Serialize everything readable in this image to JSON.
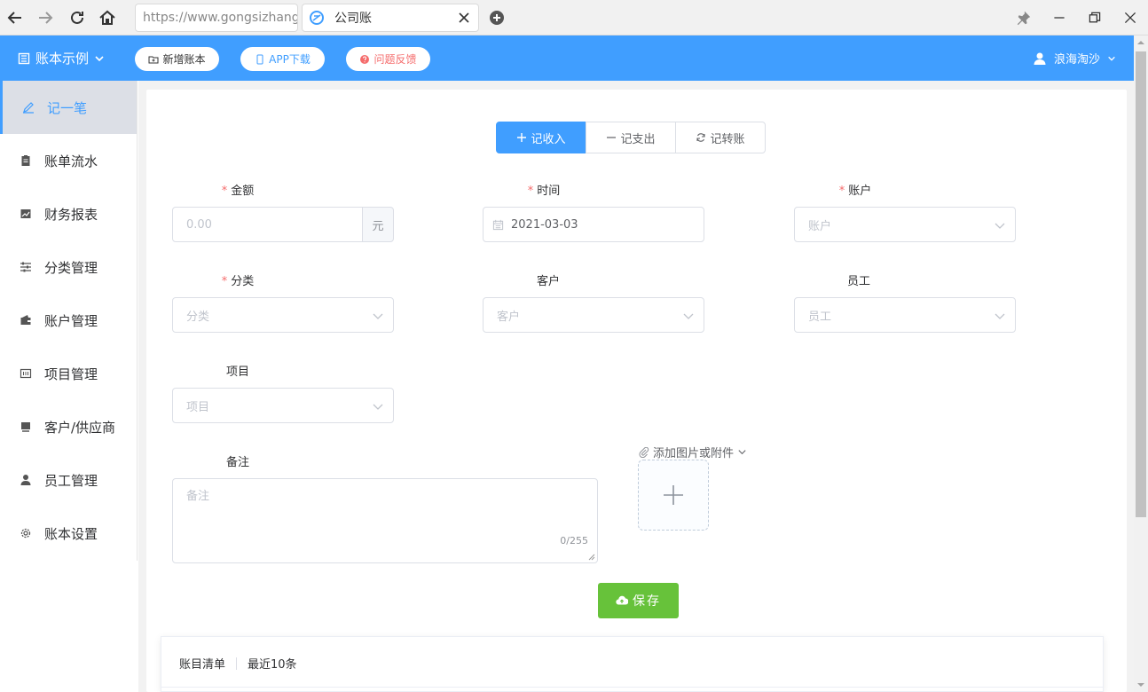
{
  "browser": {
    "url": "https://www.gongsizhang.c",
    "tab_title": "公司账"
  },
  "header": {
    "book_name": "账本示例",
    "buttons": {
      "new_book": "新增账本",
      "app_download": "APP下载",
      "feedback": "问题反馈"
    },
    "user": "浪海淘沙"
  },
  "sidebar": {
    "items": [
      {
        "label": "记一笔",
        "icon": "pen-icon",
        "active": true
      },
      {
        "label": "账单流水",
        "icon": "clipboard-icon"
      },
      {
        "label": "财务报表",
        "icon": "chart-icon"
      },
      {
        "label": "分类管理",
        "icon": "sliders-icon"
      },
      {
        "label": "账户管理",
        "icon": "wallet-icon"
      },
      {
        "label": "项目管理",
        "icon": "project-icon"
      },
      {
        "label": "客户/供应商",
        "icon": "store-icon"
      },
      {
        "label": "员工管理",
        "icon": "user-icon"
      },
      {
        "label": "账本设置",
        "icon": "gear-icon"
      }
    ]
  },
  "type_tabs": {
    "income": "记收入",
    "expense": "记支出",
    "transfer": "记转账"
  },
  "form": {
    "amount": {
      "label": "金额",
      "placeholder": "0.00",
      "suffix": "元"
    },
    "date": {
      "label": "时间",
      "value": "2021-03-03"
    },
    "account": {
      "label": "账户",
      "placeholder": "账户"
    },
    "category": {
      "label": "分类",
      "placeholder": "分类"
    },
    "customer": {
      "label": "客户",
      "placeholder": "客户"
    },
    "employee": {
      "label": "员工",
      "placeholder": "员工"
    },
    "project": {
      "label": "项目",
      "placeholder": "项目"
    },
    "remark": {
      "label": "备注",
      "placeholder": "备注",
      "count": "0/255"
    },
    "attach_label": "添加图片或附件",
    "save": "保存"
  },
  "list": {
    "title": "账目清单",
    "subtitle": "最近10条"
  },
  "colors": {
    "primary": "#409eff",
    "success": "#67c23a",
    "danger": "#f56c6c"
  }
}
